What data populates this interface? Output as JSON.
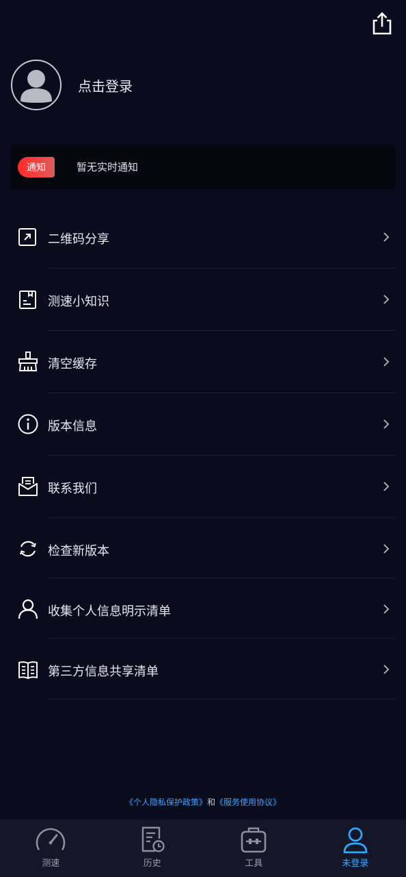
{
  "header": {
    "share_icon": "share-export-icon"
  },
  "profile": {
    "login_label": "点击登录",
    "avatar_icon": "default-avatar-icon"
  },
  "notice": {
    "badge": "通知",
    "text": "暂无实时通知"
  },
  "menu": {
    "items": [
      {
        "label": "二维码分享",
        "icon": "qr-share-icon"
      },
      {
        "label": "测速小知识",
        "icon": "knowledge-book-icon"
      },
      {
        "label": "清空缓存",
        "icon": "broom-icon"
      },
      {
        "label": "版本信息",
        "icon": "info-icon"
      },
      {
        "label": "联系我们",
        "icon": "mail-icon"
      },
      {
        "label": "检查新版本",
        "icon": "refresh-icon"
      },
      {
        "label": "收集个人信息明示清单",
        "icon": "user-icon"
      },
      {
        "label": "第三方信息共享清单",
        "icon": "open-book-icon"
      }
    ]
  },
  "legal": {
    "privacy_link": "《个人隐私保护政策》",
    "connector": "和",
    "service_link": "《服务使用协议》"
  },
  "tabbar": {
    "tabs": [
      {
        "label": "测速",
        "icon": "speedometer-icon",
        "active": false
      },
      {
        "label": "历史",
        "icon": "history-icon",
        "active": false
      },
      {
        "label": "工具",
        "icon": "toolbox-icon",
        "active": false
      },
      {
        "label": "未登录",
        "icon": "profile-icon",
        "active": true
      }
    ]
  },
  "colors": {
    "background": "#090c1d",
    "notice_badge": "#ff2a2a",
    "link": "#39a4ff",
    "tab_active": "#2fa9ff",
    "tabbar_bg": "#131727"
  }
}
